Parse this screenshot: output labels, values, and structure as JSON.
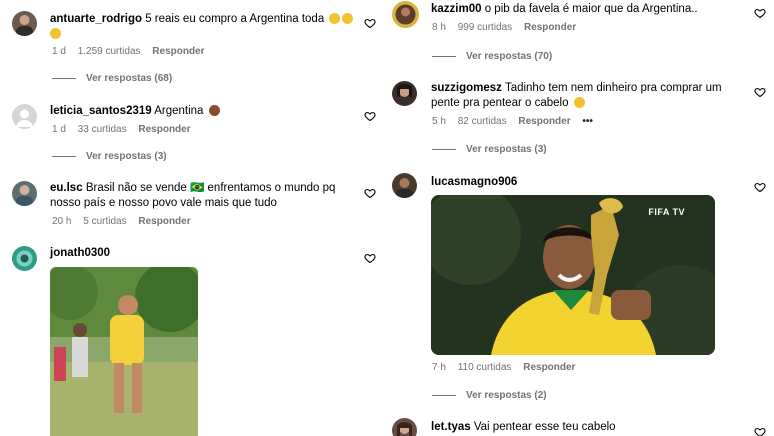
{
  "left": {
    "comments": [
      {
        "user": "antuarte_rodrigo",
        "text": "5 reais eu compro a Argentina toda",
        "time": "1 d",
        "likes": "1.259 curtidas",
        "reply": "Responder",
        "view_replies": "Ver respostas (68)"
      },
      {
        "user": "leticia_santos2319",
        "text": "Argentina",
        "time": "1 d",
        "likes": "33 curtidas",
        "reply": "Responder",
        "view_replies": "Ver respostas (3)"
      },
      {
        "user": "eu.lsc",
        "text": "Brasil não se vende 🇧🇷 enfrentamos o mundo pq nosso país e nosso povo vale mais que tudo",
        "time": "20 h",
        "likes": "5 curtidas",
        "reply": "Responder"
      },
      {
        "user": "jonath0300",
        "text": ""
      }
    ]
  },
  "right": {
    "comments": [
      {
        "user": "kazzim00",
        "text": "o pib da favela é maior que da Argentina..",
        "time": "8 h",
        "likes": "999 curtidas",
        "reply": "Responder",
        "view_replies": "Ver respostas (70)"
      },
      {
        "user": "suzzigomesz",
        "text": "Tadinho tem nem dinheiro pra comprar um pente pra pentear o cabelo",
        "time": "5 h",
        "likes": "82 curtidas",
        "reply": "Responder",
        "more": "•••",
        "view_replies": "Ver respostas (3)"
      },
      {
        "user": "lucasmagno906",
        "text": "",
        "time": "7 h",
        "likes": "110 curtidas",
        "reply": "Responder",
        "view_replies": "Ver respostas (2)",
        "gif_badge": "FIFA TV"
      },
      {
        "user": "let.tyas",
        "text": "Vai pentear esse teu cabelo"
      }
    ]
  },
  "colors": {
    "meta": "#737373",
    "text": "#000000",
    "background": "#ffffff"
  }
}
